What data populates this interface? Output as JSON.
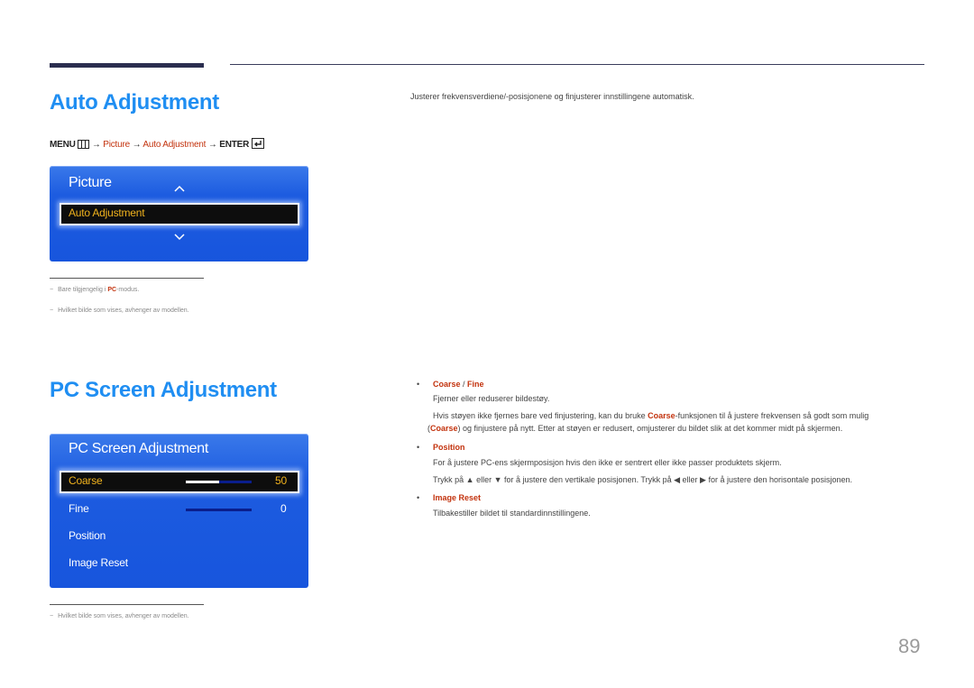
{
  "section1": {
    "title": "Auto Adjustment",
    "menu_path": {
      "menu": "MENU",
      "arrow": "→",
      "step1": "Picture",
      "step2": "Auto Adjustment",
      "enter": "ENTER"
    },
    "osd": {
      "title": "Picture",
      "selected": "Auto Adjustment",
      "up_icon": "chevron-up-icon",
      "down_icon": "chevron-down-icon"
    },
    "notes": [
      {
        "dash": "−",
        "before": "Bare tilgjengelig i ",
        "highlight": "PC",
        "after": "-modus."
      },
      {
        "dash": "−",
        "text": "Hvilket bilde som vises, avhenger av modellen."
      }
    ],
    "description": "Justerer frekvensverdiene/-posisjonene og finjusterer innstillingene automatisk."
  },
  "section2": {
    "title": "PC Screen Adjustment",
    "osd": {
      "title": "PC Screen Adjustment",
      "items": [
        {
          "label": "Coarse",
          "value": "50",
          "slider_fraction": 0.5,
          "selected": true
        },
        {
          "label": "Fine",
          "value": "0",
          "slider_fraction": 0.0,
          "selected": false
        },
        {
          "label": "Position"
        },
        {
          "label": "Image Reset"
        }
      ]
    },
    "notes": [
      {
        "dash": "−",
        "text": "Hvilket bilde som vises, avhenger av modellen."
      }
    ],
    "bullets": [
      {
        "bullet": "•",
        "head1": "Coarse",
        "sep": " / ",
        "head2": "Fine",
        "line1": "Fjerner eller reduserer bildestøy.",
        "line2_before": "Hvis støyen ikke fjernes bare ved finjustering, kan du bruke ",
        "line2_red": "Coarse",
        "line2_after": "-funksjonen til å justere frekvensen så godt som mulig",
        "line3_open": "(",
        "line3_red": "Coarse",
        "line3_after": ") og finjustere på nytt. Etter at støyen er redusert, omjusterer du bildet slik at det kommer midt på skjermen."
      },
      {
        "bullet": "•",
        "head": "Position",
        "line1": "For å justere PC-ens skjermposisjon hvis den ikke er sentrert eller ikke passer produktets skjerm.",
        "line2": "Trykk på ▲ eller ▼ for å justere den vertikale posisjonen. Trykk på ◀ eller ▶ for å justere den horisontale posisjonen."
      },
      {
        "bullet": "•",
        "head": "Image Reset",
        "line1": "Tilbakestiller bildet til standardinnstillingene."
      }
    ]
  },
  "page_number": "89"
}
